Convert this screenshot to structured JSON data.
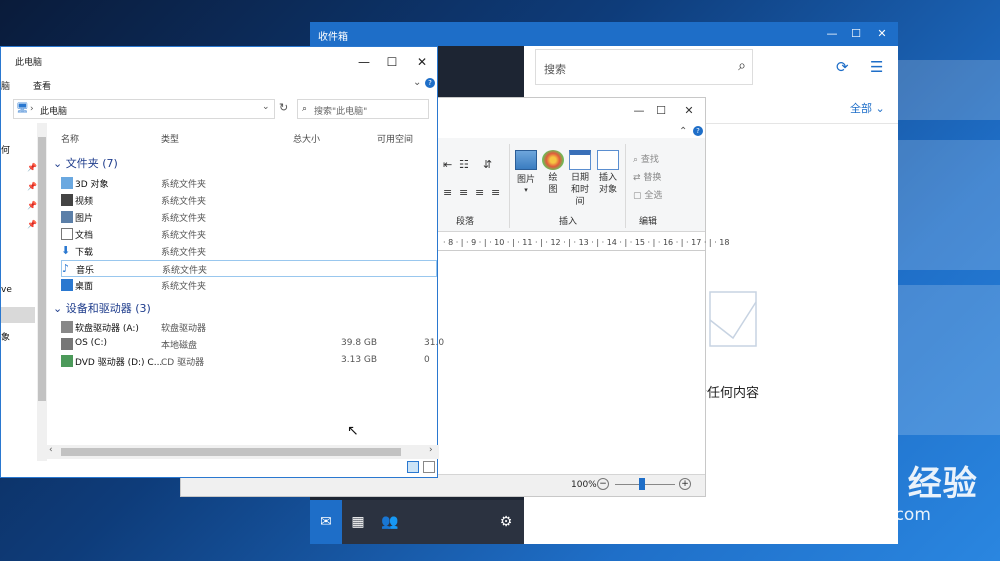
{
  "desktop": {
    "accent": "#1e6ec8"
  },
  "mail": {
    "title": "收件箱",
    "search_placeholder": "搜索",
    "filter_label": "全部",
    "empty_text": "示任何内容",
    "controls": {
      "minimize": "—",
      "maximize": "☐",
      "close": "✕"
    }
  },
  "wordpad": {
    "groups": {
      "paragraph": "段落",
      "insert": "插入",
      "edit": "编辑"
    },
    "buttons": {
      "picture": "图片",
      "paint": "绘图",
      "datetime": "日期和时间",
      "object": "插入对象"
    },
    "edit_items": [
      "查找",
      "替换",
      "全选"
    ],
    "ruler": "· 8 · | · 9 · | · 10 · | · 11 · | · 12 · | · 13 · | · 14 · | · 15 · | · 16 · | · 17 · | · 18",
    "zoom": "100%"
  },
  "explorer": {
    "title": "此电脑",
    "menu": {
      "view_tab": "查看",
      "left_tab": "脑"
    },
    "address": "此电脑",
    "search_placeholder": "搜索\"此电脑\"",
    "columns": {
      "name": "名称",
      "type": "类型",
      "total": "总大小",
      "free": "可用空间"
    },
    "folders_header": "文件夹 (7)",
    "folders": [
      {
        "name": "3D 对象",
        "type": "系统文件夹"
      },
      {
        "name": "视频",
        "type": "系统文件夹"
      },
      {
        "name": "图片",
        "type": "系统文件夹"
      },
      {
        "name": "文档",
        "type": "系统文件夹"
      },
      {
        "name": "下载",
        "type": "系统文件夹"
      },
      {
        "name": "音乐",
        "type": "系统文件夹"
      },
      {
        "name": "桌面",
        "type": "系统文件夹"
      }
    ],
    "devices_header": "设备和驱动器 (3)",
    "devices": [
      {
        "name": "软盘驱动器 (A:)",
        "type": "软盘驱动器",
        "total": "",
        "free": ""
      },
      {
        "name": "OS (C:)",
        "type": "本地磁盘",
        "total": "39.8 GB",
        "free": "31.0"
      },
      {
        "name": "DVD 驱动器 (D:) C...",
        "type": "CD 驱动器",
        "total": "3.13 GB",
        "free": "0"
      }
    ],
    "sidebar_fragments": [
      "何",
      "ve",
      "象"
    ]
  },
  "watermark": {
    "brand": "Bai  du 经验",
    "url": "jingyan.baidu.com"
  }
}
